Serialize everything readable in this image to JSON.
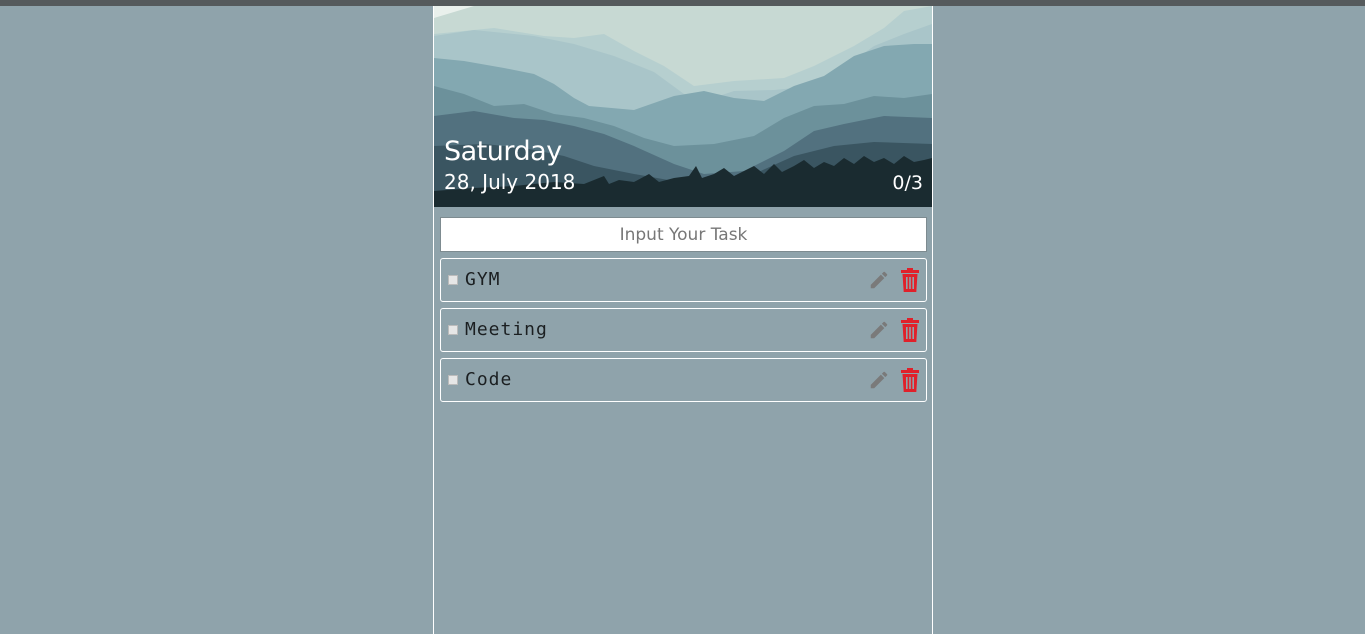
{
  "header": {
    "day": "Saturday",
    "date": "28, July 2018",
    "progress": "0/3"
  },
  "input": {
    "placeholder": "Input Your Task",
    "value": ""
  },
  "tasks": [
    {
      "label": "GYM",
      "done": false
    },
    {
      "label": "Meeting",
      "done": false
    },
    {
      "label": "Code",
      "done": false
    }
  ],
  "icons": {
    "edit": "pencil-icon",
    "delete": "trash-icon"
  },
  "colors": {
    "background": "#8fa3ab",
    "delete": "#e0202a",
    "edit": "#7a7a7a"
  }
}
